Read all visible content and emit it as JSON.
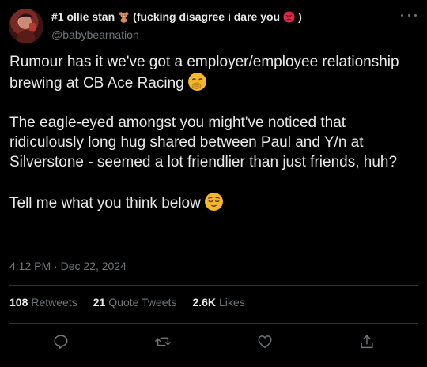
{
  "tweet": {
    "display_name": "#1 ollie stan",
    "display_name_suffix": "(fucking disagree i dare you",
    "display_name_close": ")",
    "handle": "@babybearnation",
    "paragraphs": [
      "Rumour has it we've got a employer/employee relationship brewing at CB Ace Racing",
      "The eagle-eyed amongst you might've noticed that ridiculously long hug shared between Paul and Y/n at Silverstone - seemed a lot friendlier than just friends, huh?",
      "Tell me what you think below"
    ],
    "timestamp": "4:12 PM · Dec 22, 2024",
    "stats": {
      "retweets_count": "108",
      "retweets_label": "Retweets",
      "quotes_count": "21",
      "quotes_label": "Quote Tweets",
      "likes_count": "2.6K",
      "likes_label": "Likes"
    }
  },
  "icons": {
    "bear": "teddy-bear-icon",
    "angry": "angry-face-icon",
    "hand_over_mouth": "face-with-hand-over-mouth-icon",
    "relieved": "relieved-face-icon",
    "reply": "reply-icon",
    "retweet": "retweet-icon",
    "like": "heart-icon",
    "share": "share-icon",
    "more": "more-icon"
  },
  "colors": {
    "background": "#000000",
    "text": "#e7e9ea",
    "secondary": "#71767b",
    "divider": "#2f3336"
  }
}
